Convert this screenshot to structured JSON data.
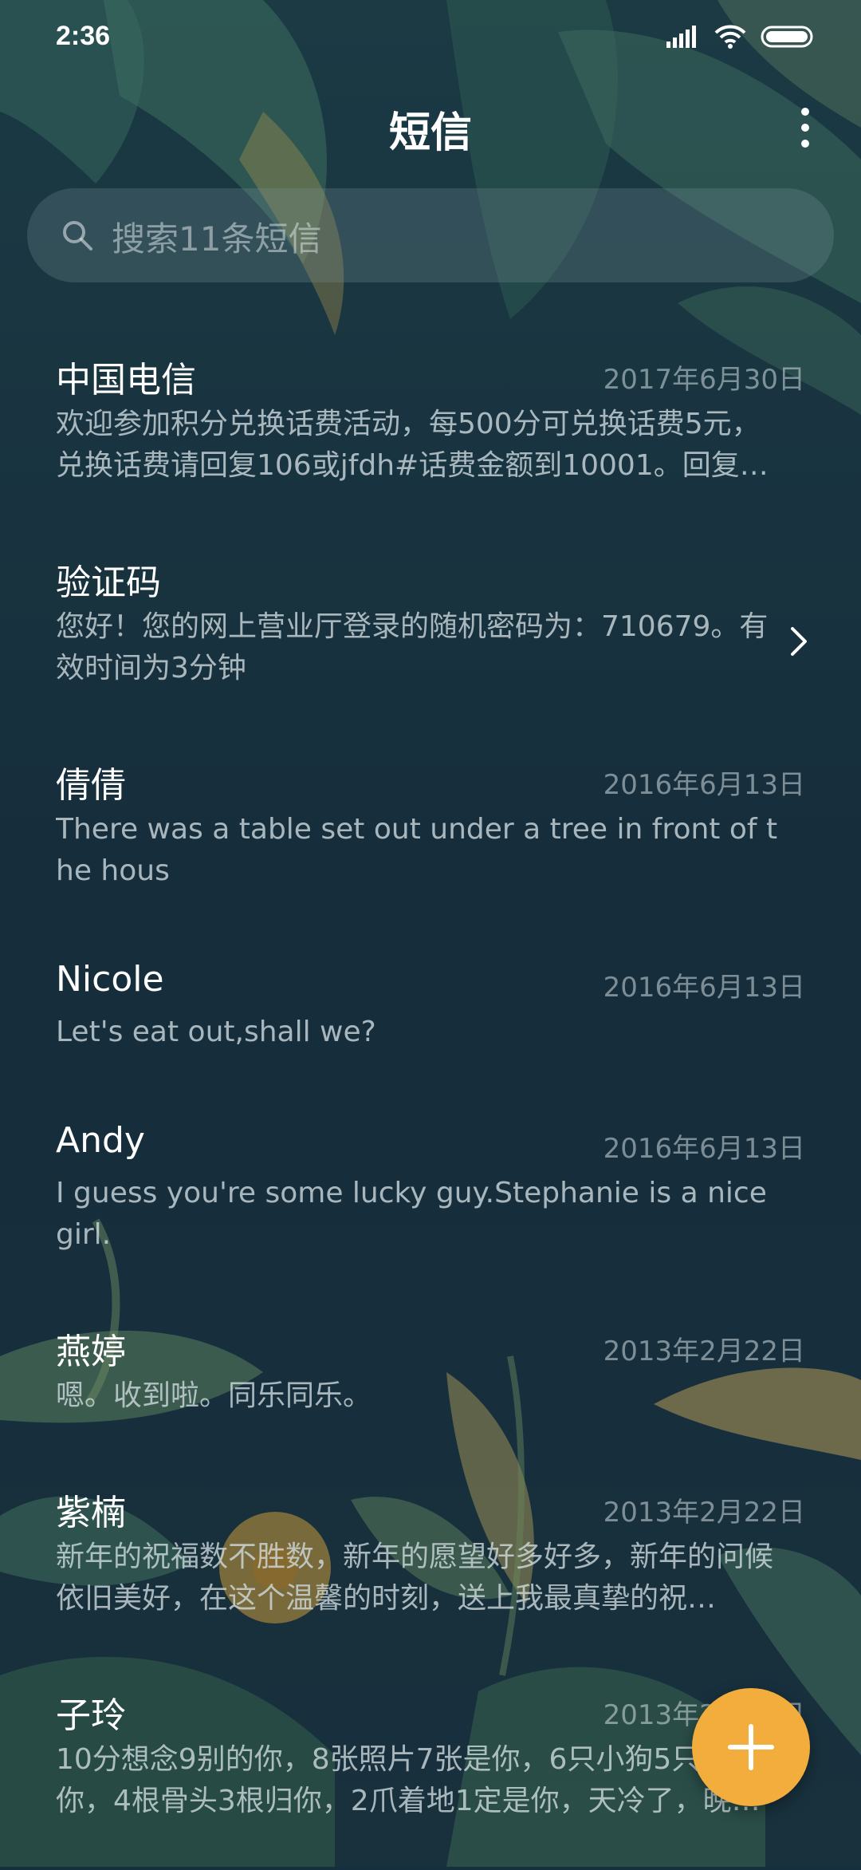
{
  "status_bar": {
    "time": "2:36"
  },
  "header": {
    "title": "短信"
  },
  "search": {
    "placeholder": "搜索11条短信"
  },
  "conversations": [
    {
      "name": "中国电信",
      "date": "2017年6月30日",
      "preview": "欢迎参加积分兑换话费活动，每500分可兑换话费5元，兑换话费请回复106或jfdh#话费金额到10001。回复…"
    },
    {
      "name": "验证码",
      "date": "",
      "preview": "您好！您的网上营业厅登录的随机密码为：710679。有效时间为3分钟",
      "chevron": true
    },
    {
      "name": "倩倩",
      "date": "2016年6月13日",
      "preview": "There was a table set out under a tree in front of the hous"
    },
    {
      "name": "Nicole",
      "date": "2016年6月13日",
      "preview": "Let's eat out,shall we?"
    },
    {
      "name": "Andy",
      "date": "2016年6月13日",
      "preview": "I guess you're some lucky guy.Stephanie is a nice girl."
    },
    {
      "name": "燕婷",
      "date": "2013年2月22日",
      "preview": "嗯。收到啦。同乐同乐。"
    },
    {
      "name": "紫楠",
      "date": "2013年2月22日",
      "preview": "新年的祝福数不胜数，新年的愿望好多好多，新年的问候依旧美好，在这个温馨的时刻，送上我最真挚的祝…"
    },
    {
      "name": "子玲",
      "date": "2013年2月22日",
      "preview": "10分想念9别的你，8张照片7张是你，6只小狗5只像你，4根骨头3根归你，2爪着地1定是你，天冷了，晚上记"
    }
  ],
  "icons": {
    "search": "search-icon",
    "more": "more-vertical-icon",
    "chevron": "chevron-right-icon",
    "fab": "plus-icon",
    "signal": "signal-icon",
    "wifi": "wifi-icon",
    "battery": "battery-icon"
  },
  "colors": {
    "background": "#17303f",
    "accent": "#f3ad3c"
  }
}
